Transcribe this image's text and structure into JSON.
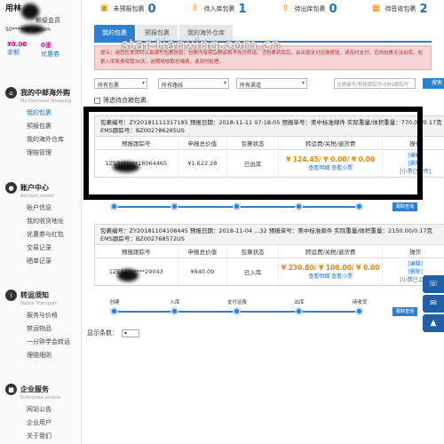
{
  "sidebar": {
    "user_name": "用林",
    "user_level": "赖级会员",
    "user_email": "50*****@qq.com",
    "balance_amount": "¥0.00",
    "balance_label": "余额",
    "coupon_count": "0张",
    "coupon_label": "优惠券",
    "sections": [
      {
        "title": "我的中邮海外购",
        "subtitle": "My Overseas Shopping",
        "icon": "home-icon",
        "items": [
          "我的包裹",
          "预报包裹",
          "我的海外仓库",
          "理赔管理"
        ]
      },
      {
        "title": "账户中心",
        "subtitle": "Account center",
        "icon": "user-icon",
        "items": [
          "账户信息",
          "我的收货地址",
          "优惠券与红包",
          "交易记录",
          "晒单记录"
        ]
      },
      {
        "title": "转运须知",
        "subtitle": "Notice Transport",
        "icon": "info-icon",
        "items": [
          "服务与价格",
          "禁运物品",
          "一分钟学会转运",
          "理赔细则"
        ]
      },
      {
        "title": "企业服务",
        "subtitle": "Enterprise service",
        "icon": "briefcase-icon",
        "items": [
          "网站公告",
          "企业用户",
          "关于我们"
        ]
      }
    ]
  },
  "stats": [
    {
      "label": "未预报包裹",
      "value": "0",
      "icon": "package-icon"
    },
    {
      "label": "待入库包裹",
      "value": "1",
      "icon": "download-icon"
    },
    {
      "label": "待出库包裹",
      "value": "0",
      "icon": "upload-icon"
    },
    {
      "label": "待签收包裹",
      "value": "2",
      "icon": "calendar-icon"
    }
  ],
  "tabs": [
    "我的包裹",
    "预报包裹",
    "我的海外仓库"
  ],
  "watermark": "star-tianxing.com.cn",
  "notice": "提示：请您在发货时认真填写包裹信息，包裹内有禁运物品将不允许转运。当包裹到库后，会出现支付运费按钮，请及时支付，否则包裹无法出库。包裹入库免费保管30天，逾期将收取仓储费，请及时处理。",
  "filters": {
    "status": "所有包裹",
    "warehouse": "所有路线",
    "channel": "所有渠道",
    "search_placeholder": "包裹编号/预报跟踪号/EMS跟踪号",
    "search_button": "搜索"
  },
  "filter2_label": "筛选待合箱包裹",
  "columns": [
    "预报跟踪号",
    "申报总价值",
    "包裹状态",
    "转运费/关税/退货费",
    "操作"
  ],
  "packages": [
    {
      "head_line1": "包裹编号：ZY20181111317185  预报日期：2018-11-11 07:18:05  预报单号：美中标准邮件  实际重量/体积重量：770.00/0.17克",
      "head_line2": "EMS跟踪号：BZ002786285US",
      "tracking": "1Z5R******18064465",
      "value": "¥1,622.28",
      "status": "已出库",
      "fee": "¥ 124.45/ ¥ 0.00/ ¥ 0.00",
      "fee_link": "查看明细 查看小票",
      "ops": [
        "[编辑]",
        "[删除]",
        "[小票已上传]"
      ]
    },
    {
      "head_line1": "包裹编号：ZY20181104108445  预报日期：2018-11-04 ...32  预报单号：美中标准邮件  实际重量/体积重量：2150.00/0.17克",
      "head_line2": "EMS跟踪号：BZ002768572US",
      "tracking": "1ZE13******29043",
      "value": "¥840.09",
      "status": "已入库",
      "fee": "¥ 230.80/ ¥ 100.00/ ¥ 0.00",
      "fee_link": "查看明细 查看小票",
      "ops": [
        "[编辑]",
        "[删除]",
        "[小票已上传]"
      ]
    }
  ],
  "progress_steps": [
    "创建",
    "入库",
    "支付运费",
    "出库",
    "待收货"
  ],
  "progress_button": "跟踪查询",
  "pager_label": "显示条数："
}
